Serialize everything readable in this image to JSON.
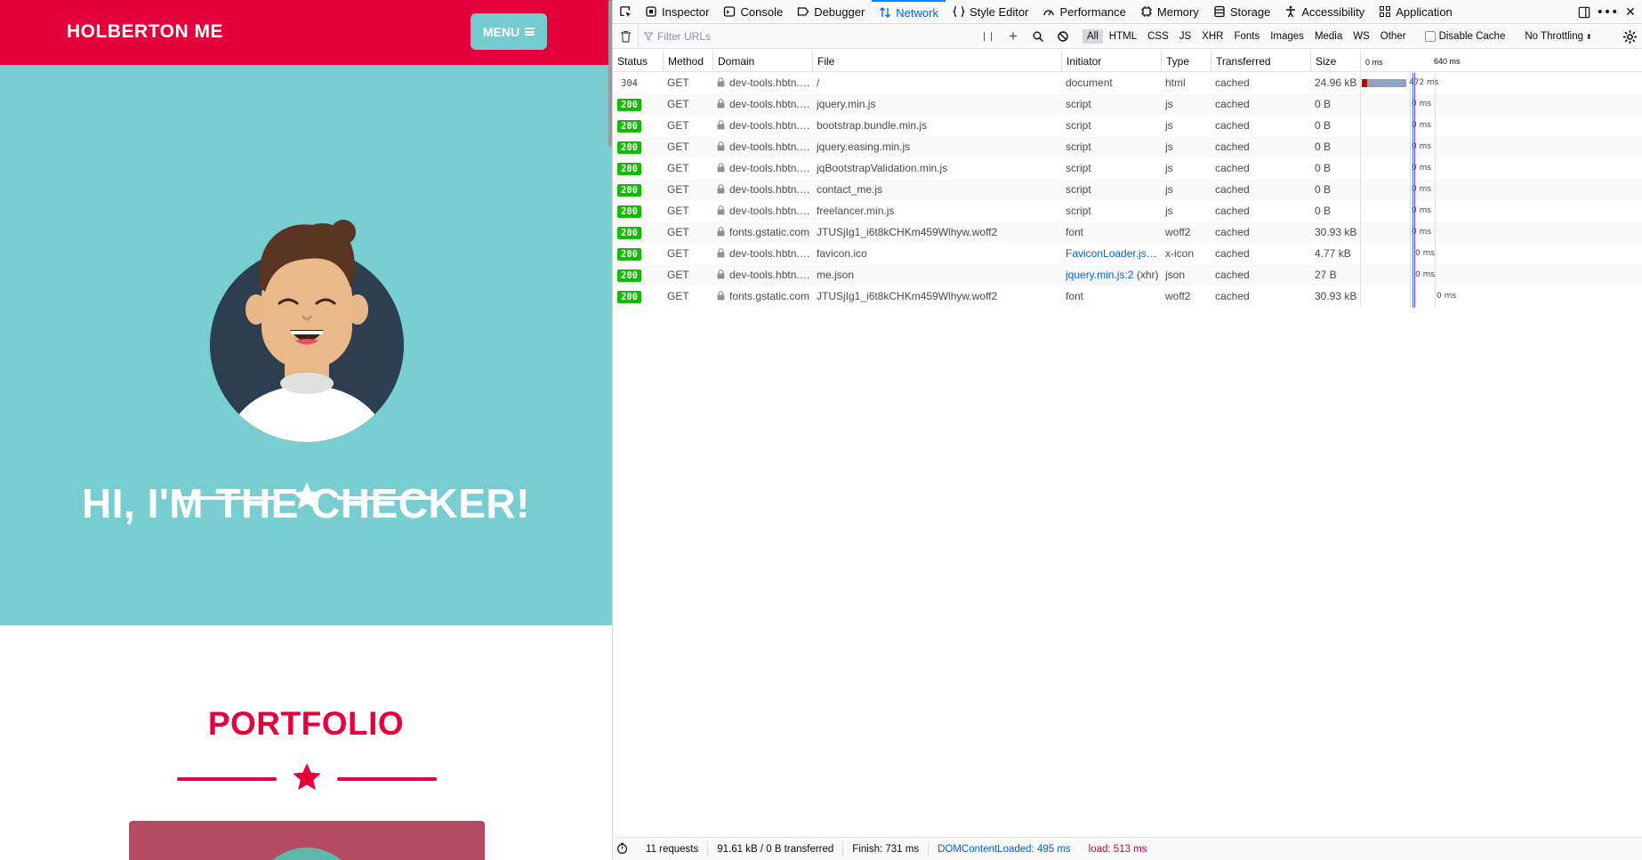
{
  "site": {
    "brand": "HOLBERTON ME",
    "menu_label": "MENU",
    "hero_title": "HI, I'M THE CHECKER!",
    "portfolio_title": "PORTFOLIO",
    "colors": {
      "primary": "#e4003b",
      "hero_bg": "#78cdd1",
      "menu_bg": "#76cbd1"
    }
  },
  "devtools": {
    "tabs": [
      {
        "label": "Inspector",
        "icon": "inspector-icon"
      },
      {
        "label": "Console",
        "icon": "console-icon"
      },
      {
        "label": "Debugger",
        "icon": "debugger-icon"
      },
      {
        "label": "Network",
        "icon": "network-icon",
        "active": true
      },
      {
        "label": "Style Editor",
        "icon": "style-editor-icon"
      },
      {
        "label": "Performance",
        "icon": "performance-icon"
      },
      {
        "label": "Memory",
        "icon": "memory-icon"
      },
      {
        "label": "Storage",
        "icon": "storage-icon"
      },
      {
        "label": "Accessibility",
        "icon": "accessibility-icon"
      },
      {
        "label": "Application",
        "icon": "application-icon"
      }
    ],
    "toolbar": {
      "filter_placeholder": "Filter URLs",
      "types": [
        "All",
        "HTML",
        "CSS",
        "JS",
        "XHR",
        "Fonts",
        "Images",
        "Media",
        "WS",
        "Other"
      ],
      "active_type": "All",
      "disable_cache": "Disable Cache",
      "throttling": "No Throttling"
    },
    "columns": [
      "Status",
      "Method",
      "Domain",
      "File",
      "Initiator",
      "Type",
      "Transferred",
      "Size"
    ],
    "waterfall_ticks": [
      "0 ms",
      "640 ms"
    ],
    "requests": [
      {
        "status": "304",
        "method": "GET",
        "domain": "dev-tools.hbtn.info",
        "file": "/",
        "initiator": "document",
        "initiator_link": false,
        "type": "html",
        "transferred": "cached",
        "size": "24.96 kB",
        "timing": "472 ms"
      },
      {
        "status": "200",
        "method": "GET",
        "domain": "dev-tools.hbtn.info",
        "file": "jquery.min.js",
        "initiator": "script",
        "initiator_link": false,
        "type": "js",
        "transferred": "cached",
        "size": "0 B",
        "timing": "0 ms"
      },
      {
        "status": "200",
        "method": "GET",
        "domain": "dev-tools.hbtn.info",
        "file": "bootstrap.bundle.min.js",
        "initiator": "script",
        "initiator_link": false,
        "type": "js",
        "transferred": "cached",
        "size": "0 B",
        "timing": "0 ms"
      },
      {
        "status": "200",
        "method": "GET",
        "domain": "dev-tools.hbtn.info",
        "file": "jquery.easing.min.js",
        "initiator": "script",
        "initiator_link": false,
        "type": "js",
        "transferred": "cached",
        "size": "0 B",
        "timing": "0 ms"
      },
      {
        "status": "200",
        "method": "GET",
        "domain": "dev-tools.hbtn.info",
        "file": "jqBootstrapValidation.min.js",
        "initiator": "script",
        "initiator_link": false,
        "type": "js",
        "transferred": "cached",
        "size": "0 B",
        "timing": "0 ms"
      },
      {
        "status": "200",
        "method": "GET",
        "domain": "dev-tools.hbtn.info",
        "file": "contact_me.js",
        "initiator": "script",
        "initiator_link": false,
        "type": "js",
        "transferred": "cached",
        "size": "0 B",
        "timing": "0 ms"
      },
      {
        "status": "200",
        "method": "GET",
        "domain": "dev-tools.hbtn.info",
        "file": "freelancer.min.js",
        "initiator": "script",
        "initiator_link": false,
        "type": "js",
        "transferred": "cached",
        "size": "0 B",
        "timing": "0 ms"
      },
      {
        "status": "200",
        "method": "GET",
        "domain": "fonts.gstatic.com",
        "file": "JTUSjIg1_i6t8kCHKm459Wlhyw.woff2",
        "initiator": "font",
        "initiator_link": false,
        "type": "woff2",
        "transferred": "cached",
        "size": "30.93 kB",
        "timing": "0 ms"
      },
      {
        "status": "200",
        "method": "GET",
        "domain": "dev-tools.hbtn.info",
        "file": "favicon.ico",
        "initiator": "FaviconLoader.jsm:18…",
        "initiator_link": true,
        "type": "x-icon",
        "transferred": "cached",
        "size": "4.77 kB",
        "timing": "0 ms"
      },
      {
        "status": "200",
        "method": "GET",
        "domain": "dev-tools.hbtn.info",
        "file": "me.json",
        "initiator": "jquery.min.js:2",
        "initiator_suffix": " (xhr)",
        "initiator_link": true,
        "type": "json",
        "transferred": "cached",
        "size": "27 B",
        "timing": "0 ms"
      },
      {
        "status": "200",
        "method": "GET",
        "domain": "fonts.gstatic.com",
        "file": "JTUSjIg1_i6t8kCHKm459Wlhyw.woff2",
        "initiator": "font",
        "initiator_link": false,
        "type": "woff2",
        "transferred": "cached",
        "size": "30.93 kB",
        "timing": "0 ms"
      }
    ],
    "statusbar": {
      "requests": "11 requests",
      "transferred": "91.61 kB / 0 B transferred",
      "finish": "Finish: 731 ms",
      "dom_loaded": "DOMContentLoaded: 495 ms",
      "load": "load: 513 ms"
    },
    "colors": {
      "ok": "#12bc00",
      "link": "#0060df",
      "dom": "#0060df",
      "load": "#c50042"
    }
  }
}
